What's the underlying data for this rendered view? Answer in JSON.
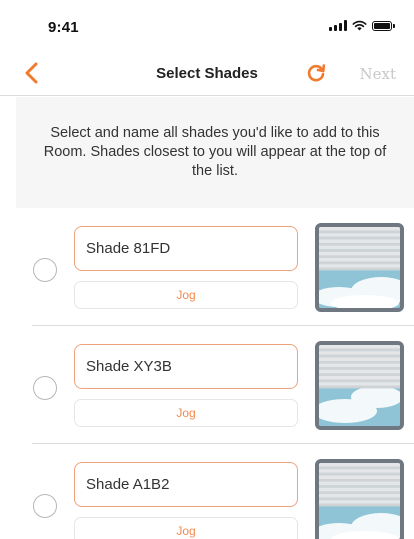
{
  "status_bar": {
    "time": "9:41"
  },
  "nav": {
    "title": "Select Shades",
    "next_label": "Next",
    "accent_color": "#f07a2e"
  },
  "instructions": "Select and name all shades you'd like to add to this Room. Shades closest to you will appear at the top of the list.",
  "shades": [
    {
      "name": "Shade 81FD",
      "jog_label": "Jog",
      "selected": false
    },
    {
      "name": "Shade XY3B",
      "jog_label": "Jog",
      "selected": false
    },
    {
      "name": "Shade A1B2",
      "jog_label": "Jog",
      "selected": false
    }
  ]
}
